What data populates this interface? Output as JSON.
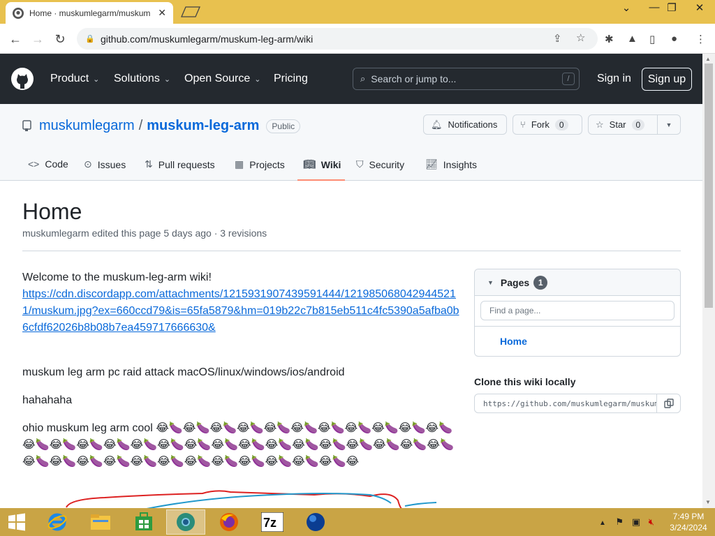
{
  "browser": {
    "tab_title": "Home · muskumlegarm/muskum",
    "address": "github.com/muskumlegarm/muskum-leg-arm/wiki"
  },
  "header": {
    "nav": [
      "Product",
      "Solutions",
      "Open Source",
      "Pricing"
    ],
    "search_placeholder": "Search or jump to...",
    "search_shortcut": "/",
    "sign_in": "Sign in",
    "sign_up": "Sign up"
  },
  "repo": {
    "owner": "muskumlegarm",
    "separator": "/",
    "name": "muskum-leg-arm",
    "visibility": "Public",
    "notifications": "Notifications",
    "fork_label": "Fork",
    "fork_count": "0",
    "star_label": "Star",
    "star_count": "0",
    "tabs": [
      "Code",
      "Issues",
      "Pull requests",
      "Projects",
      "Wiki",
      "Security",
      "Insights"
    ],
    "selected_tab": "Wiki"
  },
  "wiki": {
    "title": "Home",
    "meta": "muskumlegarm edited this page 5 days ago · 3 revisions",
    "welcome": "Welcome to the muskum-leg-arm wiki!",
    "link": "https://cdn.discordapp.com/attachments/1215931907439591444/1219850680429445211/muskum.jpg?ex=660ccd79&is=65fa5879&hm=019b22c7b815eb511c4fc5390a5afba0b6cfdf62026b8b08b7ea459717666630&",
    "line2": "muskum leg arm pc raid attack macOS/linux/windows/ios/android",
    "line3": "hahahaha",
    "line4_prefix": "ohio muskum leg arm cool ",
    "emoji_line": "😂🍆😂🍆😂🍆😂🍆😂🍆😂🍆😂🍆😂🍆😂🍆😂🍆😂🍆😂🍆😂🍆😂🍆😂🍆😂🍆😂🍆😂🍆😂🍆😂🍆😂🍆😂🍆😂🍆😂🍆😂🍆😂🍆😂🍆😂🍆😂🍆😂🍆😂🍆😂🍆😂🍆😂🍆😂🍆😂🍆😂🍆😂🍆😂🍆😂"
  },
  "sidebar": {
    "pages_label": "Pages",
    "pages_count": "1",
    "filter_placeholder": "Find a page...",
    "pages": [
      "Home"
    ],
    "clone_label": "Clone this wiki locally",
    "clone_url": "https://github.com/muskumlegarm/muskum-leg-arm.wiki.git"
  },
  "taskbar": {
    "time": "7:49 PM",
    "date": "3/24/2024"
  },
  "colors": {
    "header_bg": "#24292f",
    "link": "#0969da",
    "tab_underline": "#fd8c73",
    "taskbar": "#c9a445"
  }
}
